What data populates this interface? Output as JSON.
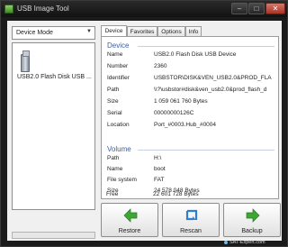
{
  "window": {
    "title": "USB Image Tool",
    "controls": {
      "minimize": "–",
      "maximize": "□",
      "close": "✕"
    }
  },
  "sidebar": {
    "mode_select": {
      "value": "Device Mode",
      "arrow": "▼"
    },
    "devices": [
      {
        "label": "USB2.0 Flash Disk USB ...",
        "icon": "usb-drive-icon"
      }
    ],
    "progress": 0
  },
  "tabs": [
    {
      "label": "Device",
      "active": true
    },
    {
      "label": "Favorites",
      "active": false
    },
    {
      "label": "Options",
      "active": false
    },
    {
      "label": "Info",
      "active": false
    }
  ],
  "details": {
    "device_section": "Device",
    "device_rows": [
      {
        "label": "Name",
        "value": "USB2.0 Flash Disk USB Device"
      },
      {
        "label": "Number",
        "value": "2360"
      },
      {
        "label": "Identifier",
        "value": "USBSTOR\\DISK&VEN_USB2.0&PROD_FLA"
      },
      {
        "label": "Path",
        "value": "\\\\?\\usbstor#disk&ven_usb2.0&prod_flash_d"
      },
      {
        "label": "Size",
        "value": "1 059 061 760 Bytes"
      },
      {
        "label": "Serial",
        "value": "00000000126C"
      },
      {
        "label": "Location",
        "value": "Port_#0003.Hub_#0004"
      }
    ],
    "volume_section": "Volume",
    "volume_rows": [
      {
        "label": "Path",
        "value": "H:\\"
      },
      {
        "label": "Name",
        "value": "boot"
      },
      {
        "label": "File system",
        "value": "FAT"
      },
      {
        "label": "Size",
        "value": "24 578 048 Bytes"
      },
      {
        "label": "Free",
        "value": "22 601 728 Bytes"
      }
    ]
  },
  "actions": {
    "restore": {
      "label": "Restore",
      "icon": "arrow-left-icon",
      "color": "#3fa535"
    },
    "rescan": {
      "label": "Rescan",
      "icon": "rescan-icon",
      "color": "#2f7fd0"
    },
    "backup": {
      "label": "Backup",
      "icon": "arrow-right-icon",
      "color": "#3fa535"
    }
  },
  "watermark": "SAT-Expert.com"
}
